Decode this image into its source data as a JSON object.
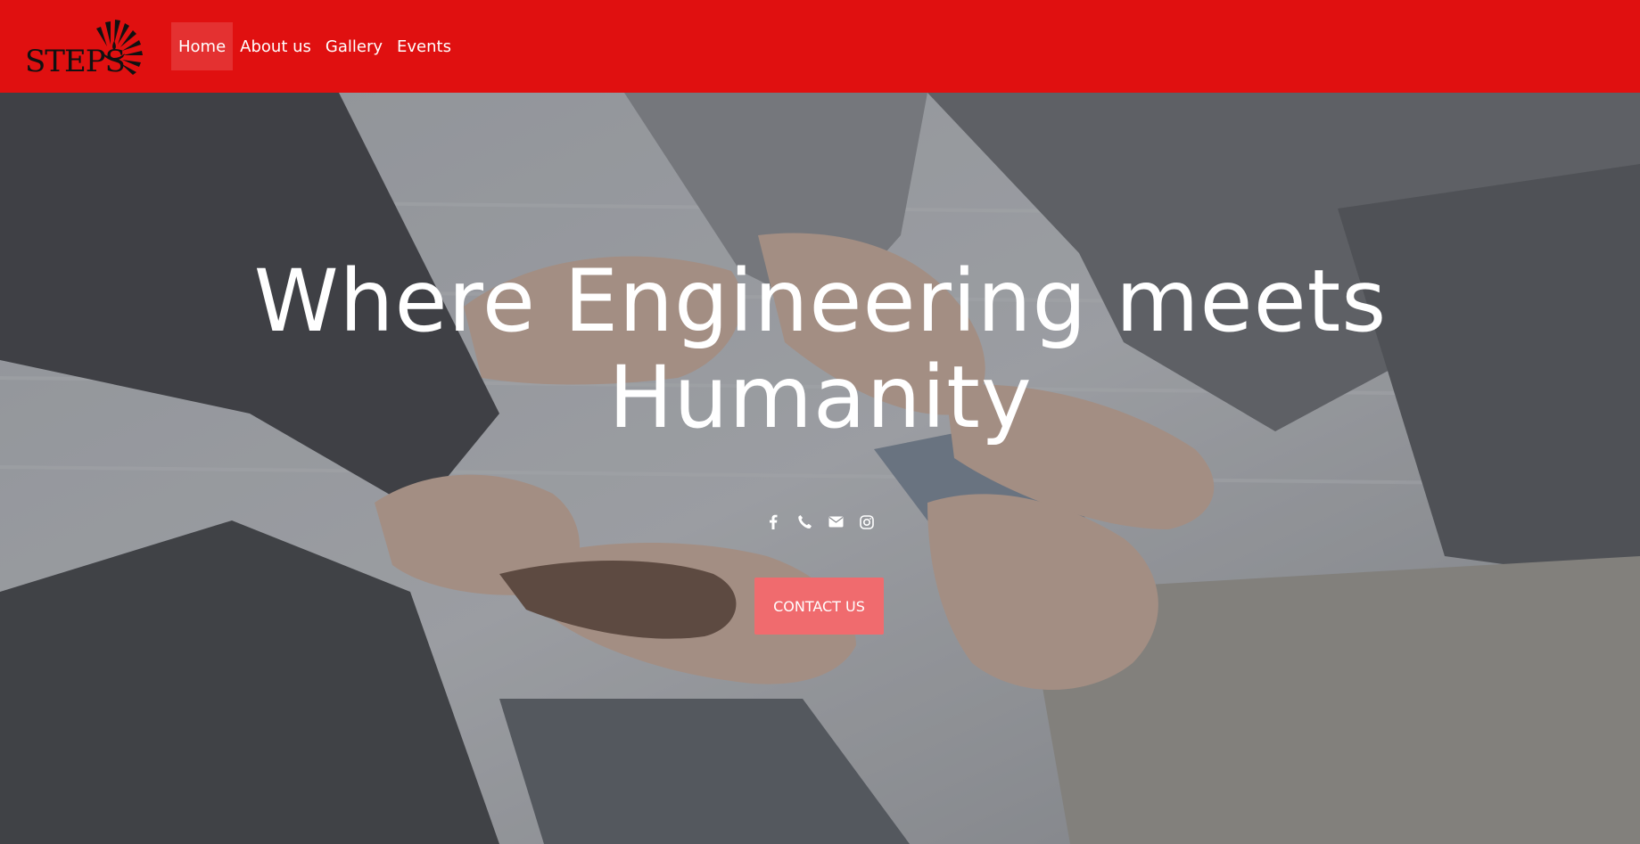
{
  "brand": {
    "logo_text": "STEPS"
  },
  "nav": {
    "items": [
      {
        "label": "Home",
        "active": true
      },
      {
        "label": "About us",
        "active": false
      },
      {
        "label": "Gallery",
        "active": false
      },
      {
        "label": "Events",
        "active": false
      }
    ]
  },
  "hero": {
    "title_line1": "Where Engineering meets",
    "title_line2": "Humanity",
    "contact_label": "CONTACT US",
    "social_icons": [
      "facebook-icon",
      "phone-icon",
      "envelope-icon",
      "instagram-icon"
    ]
  },
  "colors": {
    "navbar": "#e01010",
    "button": "#f06b6e",
    "text": "#ffffff"
  }
}
